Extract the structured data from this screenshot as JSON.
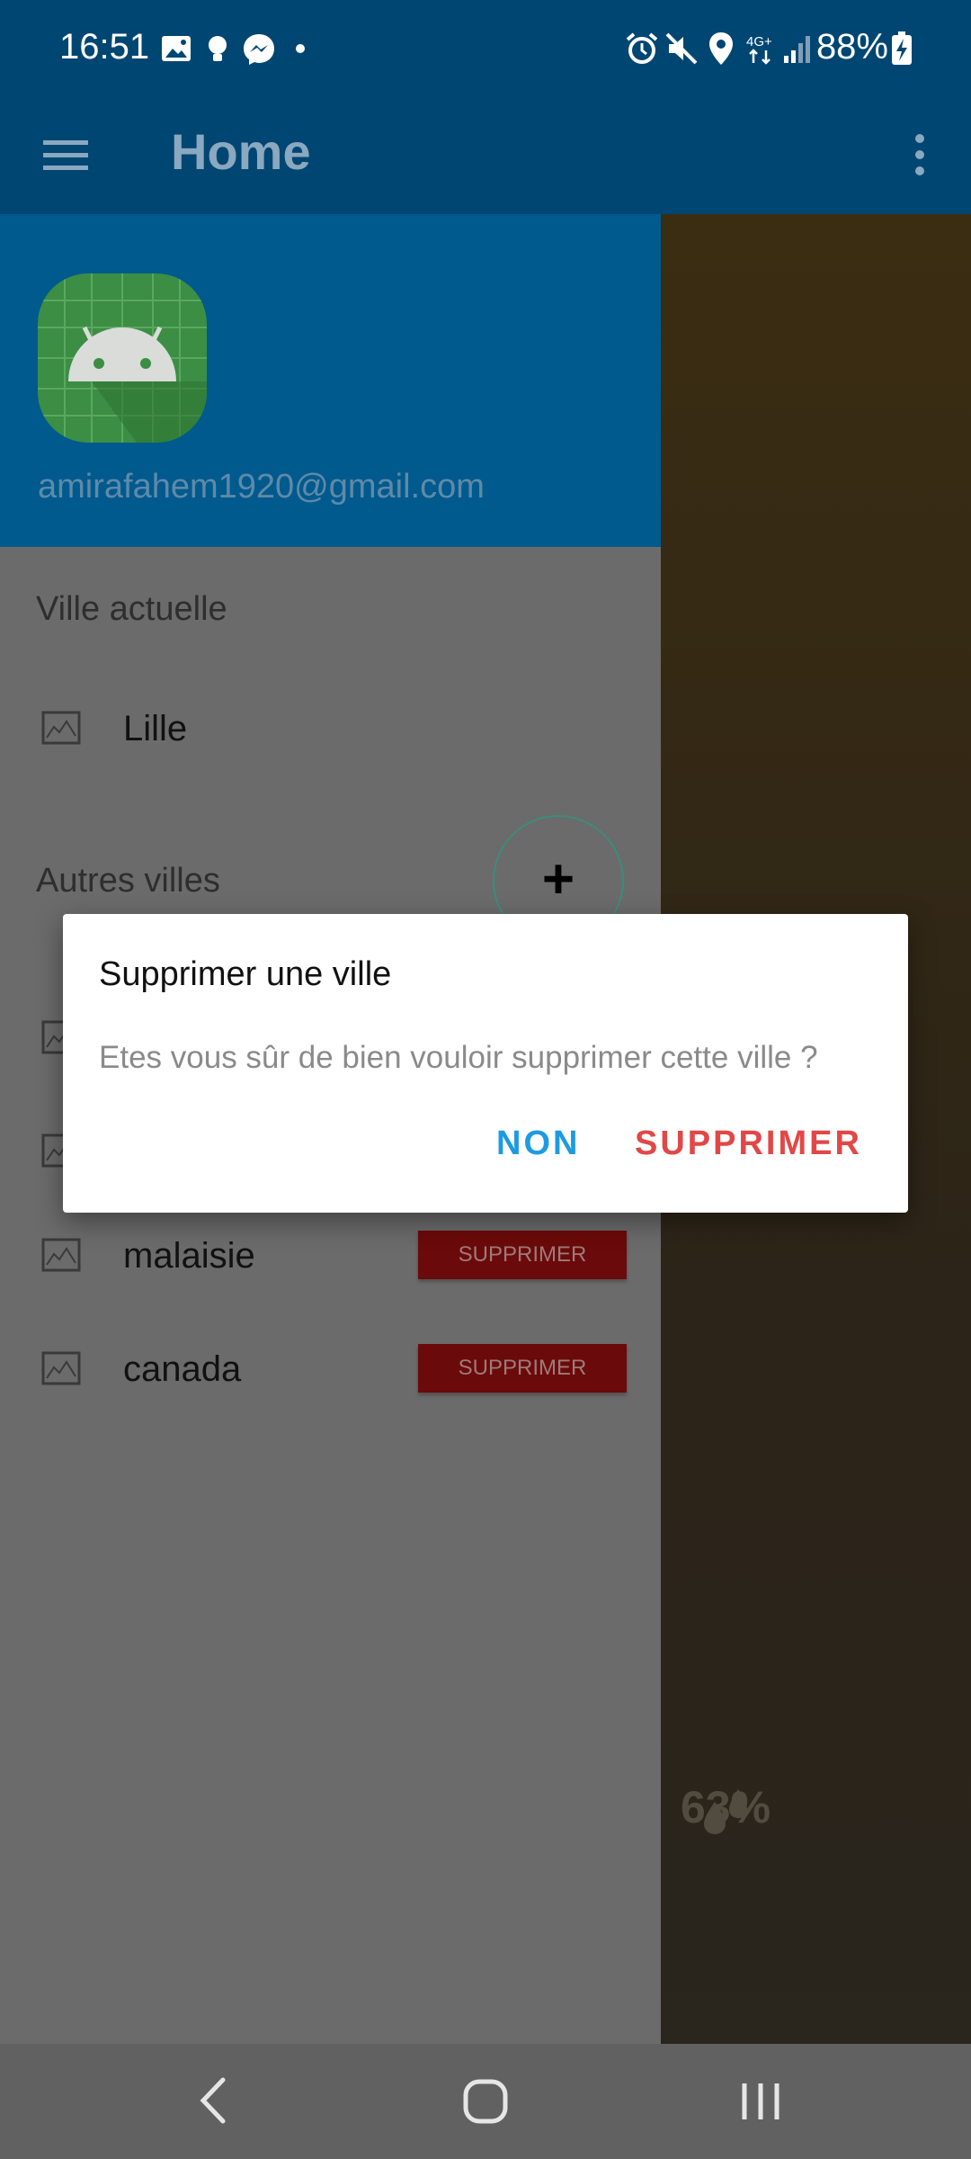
{
  "status_bar": {
    "time": "16:51",
    "battery": "88%"
  },
  "app_bar": {
    "title": "Home"
  },
  "drawer": {
    "email": "amirafahem1920@gmail.com",
    "current_city_title": "Ville actuelle",
    "current_city": "Lille",
    "other_cities_title": "Autres villes",
    "add_button": "+",
    "other_cities": [
      {
        "name": "malaisie",
        "delete_label": "SUPPRIMER"
      },
      {
        "name": "canada",
        "delete_label": "SUPPRIMER"
      }
    ]
  },
  "background": {
    "humidity": "63%"
  },
  "dialog": {
    "title": "Supprimer une ville",
    "message": "Etes vous sûr de bien vouloir supprimer cette ville ?",
    "cancel_label": "NON",
    "confirm_label": "SUPPRIMER"
  },
  "colors": {
    "primary": "#004673",
    "drawer_header": "#005a8e",
    "accent_blue": "#1e9be0",
    "accent_red": "#e24747",
    "delete_red": "#6b0a0a"
  }
}
